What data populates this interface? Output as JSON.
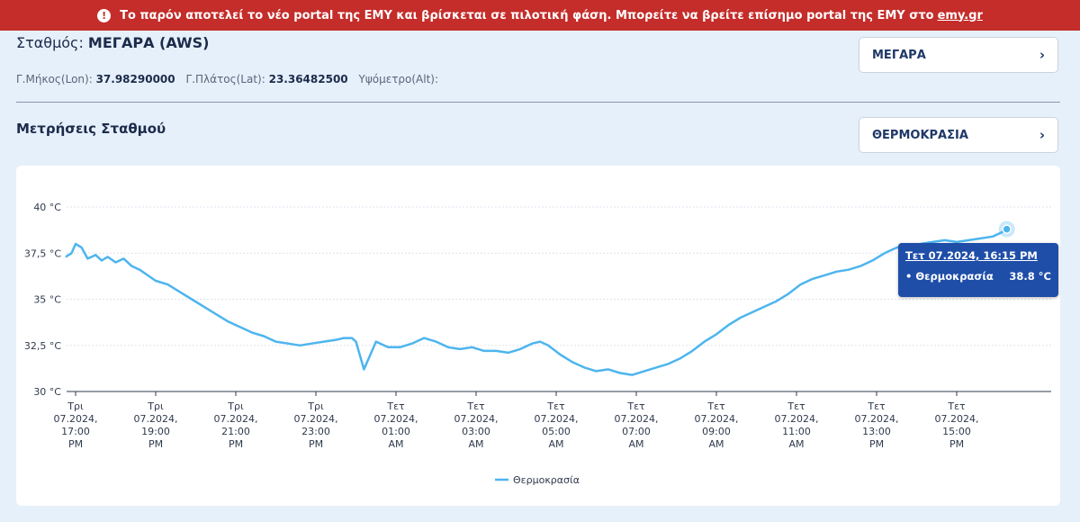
{
  "banner": {
    "icon": "exclamation-icon",
    "text": "Το παρόν αποτελεί το νέο portal της ΕΜΥ και βρίσκεται σε πιλοτική φάση. Μπορείτε να βρείτε επίσημο portal της ΕΜΥ στο",
    "link_text": "emy.gr"
  },
  "station": {
    "label": "Σταθμός:",
    "name": "ΜΕΓΑΡΑ (AWS)",
    "lon_label": "Γ.Μήκος(Lon):",
    "lon_value": "37.98290000",
    "lat_label": "Γ.Πλάτος(Lat):",
    "lat_value": "23.36482500",
    "alt_label": "Υψόμετρο(Alt):",
    "select_value": "ΜΕΓΑΡΑ"
  },
  "measurements": {
    "title": "Μετρήσεις Σταθμού",
    "select_value": "ΘΕΡΜΟΚΡΑΣΙΑ"
  },
  "tooltip": {
    "date": "Τετ 07.2024, 16:15 PM",
    "series": "• Θερμοκρασία",
    "value": "38.8 °C"
  },
  "colors": {
    "line": "#4db5ee",
    "banner": "#c42d2a",
    "tooltip": "#1f4ea8",
    "accent": "#1f3867"
  },
  "chart_data": {
    "type": "line",
    "legend": "Θερμοκρασία",
    "legend_position": "bottom-center",
    "ylim": [
      30,
      40
    ],
    "y_ticks": [
      {
        "value": 30,
        "label": "30 °C"
      },
      {
        "value": 32.5,
        "label": "32,5 °C"
      },
      {
        "value": 35,
        "label": "35 °C"
      },
      {
        "value": 37.5,
        "label": "37,5 °C"
      },
      {
        "value": 40,
        "label": "40 °C"
      }
    ],
    "x_range": [
      16.5,
      16.5
    ],
    "x_ticks": [
      {
        "hour": 17,
        "lines": [
          "Τρι",
          "07.2024,",
          "17:00",
          "PM"
        ]
      },
      {
        "hour": 19,
        "lines": [
          "Τρι",
          "07.2024,",
          "19:00",
          "PM"
        ]
      },
      {
        "hour": 21,
        "lines": [
          "Τρι",
          "07.2024,",
          "21:00",
          "PM"
        ]
      },
      {
        "hour": 23,
        "lines": [
          "Τρι",
          "07.2024,",
          "23:00",
          "PM"
        ]
      },
      {
        "hour": 25,
        "lines": [
          "Τετ",
          "07.2024,",
          "01:00",
          "AM"
        ]
      },
      {
        "hour": 27,
        "lines": [
          "Τετ",
          "07.2024,",
          "03:00",
          "AM"
        ]
      },
      {
        "hour": 29,
        "lines": [
          "Τετ",
          "07.2024,",
          "05:00",
          "AM"
        ]
      },
      {
        "hour": 31,
        "lines": [
          "Τετ",
          "07.2024,",
          "07:00",
          "AM"
        ]
      },
      {
        "hour": 33,
        "lines": [
          "Τετ",
          "07.2024,",
          "09:00",
          "AM"
        ]
      },
      {
        "hour": 35,
        "lines": [
          "Τετ",
          "07.2024,",
          "11:00",
          "AM"
        ]
      },
      {
        "hour": 37,
        "lines": [
          "Τετ",
          "07.2024,",
          "13:00",
          "PM"
        ]
      },
      {
        "hour": 39,
        "lines": [
          "Τετ",
          "07.2024,",
          "15:00",
          "PM"
        ]
      }
    ],
    "series": [
      {
        "name": "Θερμοκρασία",
        "x": [
          16.75,
          16.9,
          17.0,
          17.15,
          17.3,
          17.5,
          17.65,
          17.8,
          18.0,
          18.2,
          18.4,
          18.6,
          18.8,
          19.0,
          19.3,
          19.6,
          19.9,
          20.2,
          20.5,
          20.8,
          21.1,
          21.4,
          21.7,
          22.0,
          22.3,
          22.6,
          22.9,
          23.2,
          23.5,
          23.7,
          23.9,
          24.0,
          24.2,
          24.5,
          24.8,
          25.1,
          25.4,
          25.7,
          26.0,
          26.3,
          26.6,
          26.9,
          27.2,
          27.5,
          27.8,
          28.1,
          28.4,
          28.6,
          28.8,
          29.1,
          29.4,
          29.7,
          30.0,
          30.3,
          30.6,
          30.9,
          31.2,
          31.5,
          31.8,
          32.1,
          32.4,
          32.7,
          33.0,
          33.3,
          33.6,
          33.9,
          34.2,
          34.5,
          34.8,
          35.1,
          35.4,
          35.7,
          36.0,
          36.3,
          36.6,
          36.9,
          37.2,
          37.5,
          37.8,
          38.1,
          38.4,
          38.7,
          39.0,
          39.3,
          39.6,
          39.9,
          40.1,
          40.25
        ],
        "values": [
          37.3,
          37.5,
          38.0,
          37.8,
          37.2,
          37.4,
          37.1,
          37.3,
          37.0,
          37.2,
          36.8,
          36.6,
          36.3,
          36.0,
          35.8,
          35.4,
          35.0,
          34.6,
          34.2,
          33.8,
          33.5,
          33.2,
          33.0,
          32.7,
          32.6,
          32.5,
          32.6,
          32.7,
          32.8,
          32.9,
          32.9,
          32.7,
          31.2,
          32.7,
          32.4,
          32.4,
          32.6,
          32.9,
          32.7,
          32.4,
          32.3,
          32.4,
          32.2,
          32.2,
          32.1,
          32.3,
          32.6,
          32.7,
          32.5,
          32.0,
          31.6,
          31.3,
          31.1,
          31.2,
          31.0,
          30.9,
          31.1,
          31.3,
          31.5,
          31.8,
          32.2,
          32.7,
          33.1,
          33.6,
          34.0,
          34.3,
          34.6,
          34.9,
          35.3,
          35.8,
          36.1,
          36.3,
          36.5,
          36.6,
          36.8,
          37.1,
          37.5,
          37.8,
          37.9,
          38.0,
          38.1,
          38.2,
          38.1,
          38.2,
          38.3,
          38.4,
          38.6,
          38.8
        ]
      }
    ]
  }
}
